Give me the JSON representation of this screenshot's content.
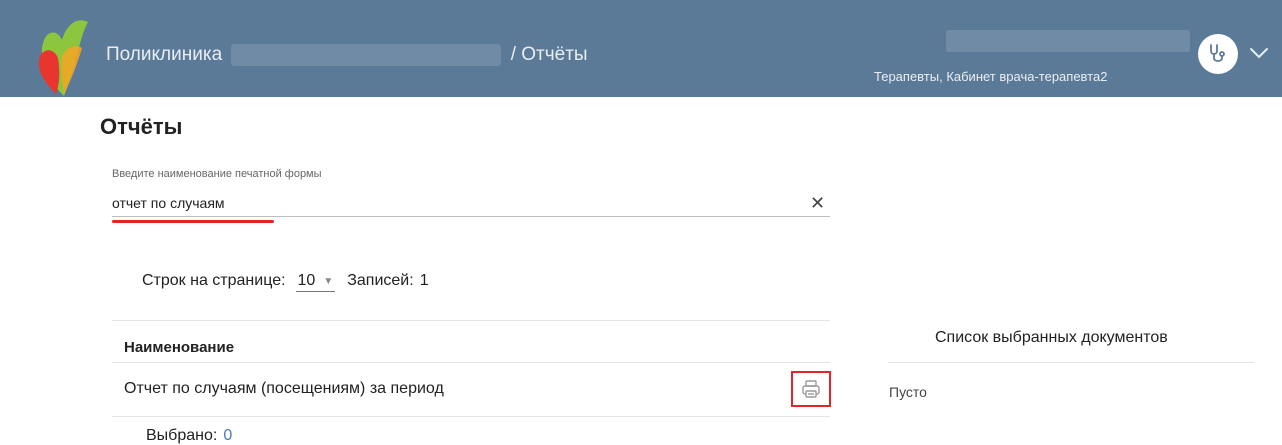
{
  "header": {
    "app_title": "Поликлиника",
    "section": "/ Отчёты",
    "user_role": "Терапевты, Кабинет врача-терапевта2",
    "avatar_icon": "stethoscope-icon",
    "menu_icon": "chevron-down-icon",
    "bg_color": "#5b7a97"
  },
  "page": {
    "title": "Отчёты"
  },
  "search": {
    "label": "Введите наименование печатной формы",
    "value": "отчет по случаям",
    "clear_icon": "close-icon"
  },
  "pager": {
    "rows_label": "Строк на странице:",
    "rows_value": "10",
    "records_label": "Записей:",
    "records_value": "1"
  },
  "table": {
    "column_header": "Наименование",
    "rows": [
      {
        "name": "Отчет по случаям (посещениям) за период",
        "action_icon": "print-icon"
      }
    ]
  },
  "selection": {
    "label": "Выбрано:",
    "count": "0"
  },
  "side_panel": {
    "title": "Список выбранных документов",
    "empty_text": "Пусто"
  },
  "colors": {
    "accent_red": "#e3242b",
    "link_blue": "#4a7ab0"
  }
}
